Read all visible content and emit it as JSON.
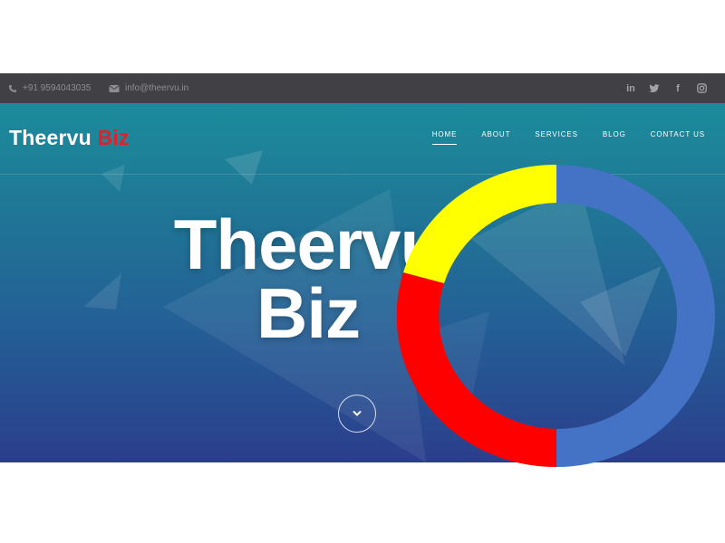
{
  "topbar": {
    "phone": "+91 9594043035",
    "email": "info@theervu.in",
    "social_icons": [
      "linkedin-icon",
      "twitter-icon",
      "facebook-icon",
      "instagram-icon"
    ]
  },
  "header": {
    "logo_main": "Theervu",
    "logo_accent": "Biz",
    "nav": [
      {
        "label": "HOME",
        "active": true
      },
      {
        "label": "ABOUT",
        "active": false
      },
      {
        "label": "SERVICES",
        "active": false
      },
      {
        "label": "BLOG",
        "active": false
      },
      {
        "label": "CONTACT US",
        "active": false
      }
    ]
  },
  "hero": {
    "title_line1": "Theervu",
    "title_line2": "Biz",
    "scroll_icon": "chevron-down-icon"
  },
  "donut": {
    "segments": [
      {
        "color": "#4472c4",
        "share": 0.5
      },
      {
        "color": "#ff0000",
        "share": 0.25
      },
      {
        "color": "#ffff00",
        "share": 0.25
      }
    ]
  },
  "colors": {
    "topbar_bg": "#414045",
    "logo_accent": "#e51f27",
    "hero_top": "#1c8c9c",
    "hero_bottom": "#2b3e8c"
  }
}
